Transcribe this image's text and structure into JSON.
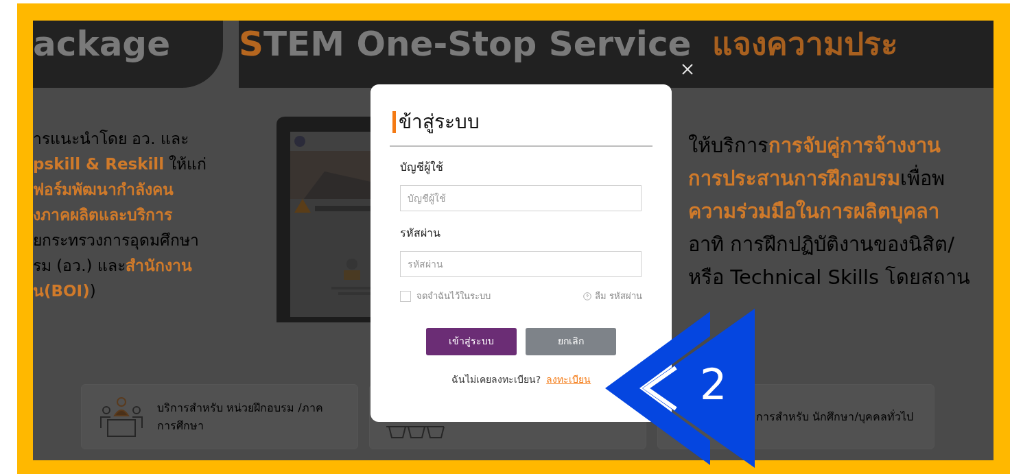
{
  "page_header": {
    "left_title": "ackage",
    "title_parts": [
      {
        "text": "S",
        "accent": true
      },
      {
        "text": "TEM One-Stop Service",
        "accent": false
      }
    ],
    "notice": "แจงความประ"
  },
  "intro_left": {
    "lines": [
      [
        {
          "text": "ารแนะนำโดย อว. และ",
          "accent": false
        }
      ],
      [
        {
          "text": "pskill & Reskill",
          "accent": true
        },
        {
          "text": " ให้แก่",
          "accent": false
        }
      ],
      [
        {
          "text": "ฟอร์มพัฒนากำลังคน",
          "accent": true
        }
      ],
      [
        {
          "text": "งภาคผลิตและบริการ",
          "accent": true
        }
      ],
      [
        {
          "text": "ยกระทรวงการอุดมศึกษา",
          "accent": false
        }
      ],
      [
        {
          "text": "รม (อว.) และ",
          "accent": false
        },
        {
          "text": "สำนักงาน",
          "accent": true
        }
      ],
      [
        {
          "text": "น(BOI)",
          "accent": true
        },
        {
          "text": ")",
          "accent": false
        }
      ]
    ]
  },
  "intro_right": {
    "lines": [
      [
        {
          "text": "ให้บริการ",
          "accent": false
        },
        {
          "text": "การจับคู่การจ้างงาน",
          "accent": true
        }
      ],
      [
        {
          "text": "การประสานการฝึกอบรม",
          "accent": true
        },
        {
          "text": "เพื่อพ",
          "accent": false
        }
      ],
      [
        {
          "text": "ความร่วมมือในการผลิตบุคลา",
          "accent": true
        }
      ],
      [
        {
          "text": "อาทิ การฝึกปฏิบัติงานของนิสิต/",
          "accent": false
        }
      ],
      [
        {
          "text": "หรือ Technical Skills โดยสถาน",
          "accent": false
        }
      ]
    ]
  },
  "service_cards": [
    {
      "kind": "people",
      "label": "บริการสำหรับ หน่วยฝึกอบรม /ภาค การศึกษา"
    },
    {
      "kind": "devices"
    },
    {
      "kind": "person",
      "label": "การสำหรับ นักศึกษา/บุคคลทั่วไป"
    }
  ],
  "login_dialog": {
    "title": "ข้าสู่ระบบ",
    "fields": [
      {
        "label": "บัญชีผู้ใช้",
        "placeholder": "บัญชีผู้ใช้"
      },
      {
        "label": "รหัสผ่าน",
        "placeholder": "รหัสผ่าน"
      }
    ],
    "remember": {
      "label": "จดจำฉันไว้ในระบบ",
      "checked": false
    },
    "forgot": "ลืม รหัสผ่าน",
    "buttons": [
      {
        "label": "เข้าสู่ระบบ",
        "kind": "primary"
      },
      {
        "label": "ยกเลิก",
        "kind": "secondary"
      }
    ],
    "register_prompt": "ฉันไม่เคยลงทะเบียน?",
    "register_link": "ลงทะเบียน"
  },
  "annotation": {
    "number": "2"
  }
}
